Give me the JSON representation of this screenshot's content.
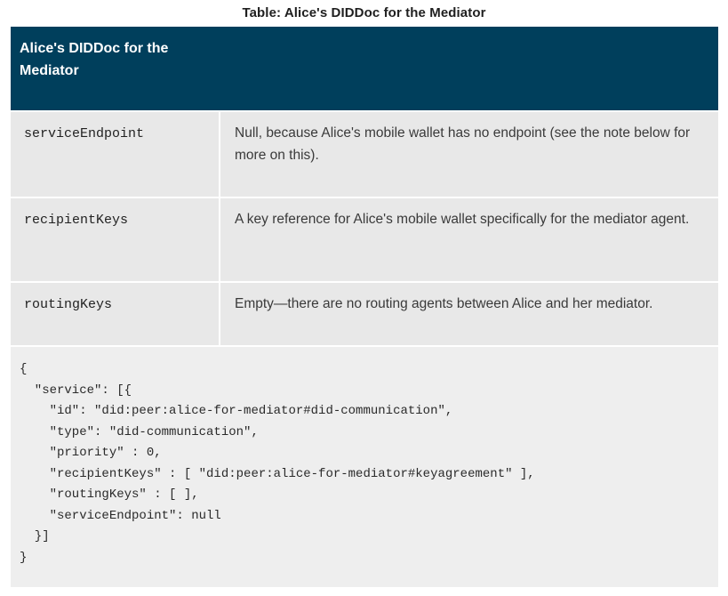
{
  "caption": "Table: Alice's DIDDoc for the Mediator",
  "table": {
    "header": "Alice's DIDDoc for the Mediator",
    "rows": [
      {
        "key": "serviceEndpoint",
        "value": "Null, because Alice's mobile wallet has no endpoint (see the note below for more on this)."
      },
      {
        "key": "recipientKeys",
        "value": "A key reference for Alice's mobile wallet specifically for the mediator agent."
      },
      {
        "key": "routingKeys",
        "value": "Empty—there are no routing agents between Alice and her mediator."
      }
    ],
    "code": "{\n  \"service\": [{\n    \"id\": \"did:peer:alice-for-mediator#did-communication\",\n    \"type\": \"did-communication\",\n    \"priority\" : 0,\n    \"recipientKeys\" : [ \"did:peer:alice-for-mediator#keyagreement\" ],\n    \"routingKeys\" : [ ],\n    \"serviceEndpoint\": null\n  }]\n}"
  }
}
